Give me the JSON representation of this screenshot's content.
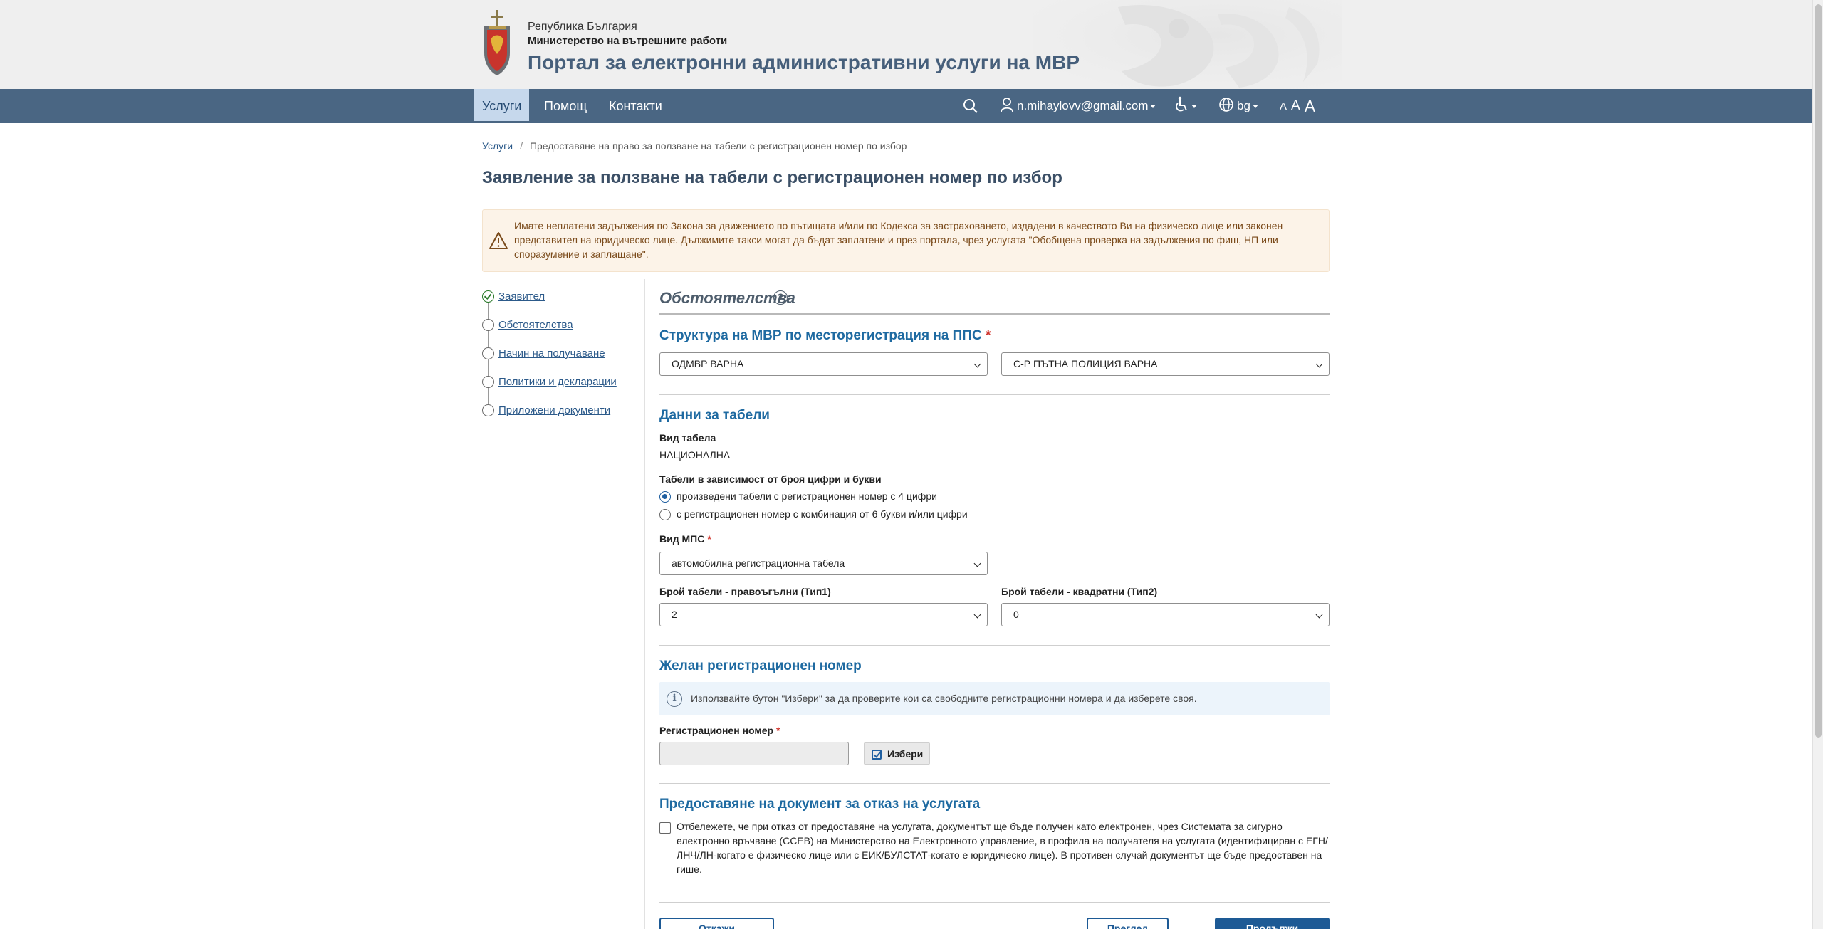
{
  "header": {
    "line1": "Република България",
    "line2": "Министерство на вътрешните работи",
    "line3": "Портал за електронни административни услуги на МВР"
  },
  "nav": {
    "items": [
      {
        "label": "Услуги",
        "active": true
      },
      {
        "label": "Помощ",
        "active": false
      },
      {
        "label": "Контакти",
        "active": false
      }
    ],
    "user_email": "n.mihaylovv@gmail.com",
    "language": "bg",
    "font_size_labels": [
      "A",
      "A",
      "A"
    ]
  },
  "breadcrumb": {
    "root": "Услуги",
    "separator": "/",
    "current": "Предоставяне на право за ползване на табели с регистрационен номер по избор"
  },
  "page_title": "Заявление за ползване на табели с регистрационен номер по избор",
  "alert": {
    "text": "Имате неплатени задължения по Закона за движението по пътищата и/или по Кодекса за застраховането, издадени в качеството Ви на физическо лице или законен представител на юридическо лице. Дължимите такси могат да бъдат заплатени и през портала, чрез услугата \"Обобщена проверка на задължения по фиш, НП или споразумение и заплащане\"."
  },
  "steps": [
    {
      "label": "Заявител",
      "done": true
    },
    {
      "label": "Обстоятелства",
      "done": false
    },
    {
      "label": "Начин на получаване",
      "done": false
    },
    {
      "label": "Политики и декларации",
      "done": false
    },
    {
      "label": "Приложени документи",
      "done": false
    }
  ],
  "form": {
    "section_title": "Обстоятелства",
    "help_symbol": "?",
    "structure": {
      "heading": "Структура на МВР по месторегистрация на ППС",
      "required_mark": "*",
      "select1": "ОДМВР ВАРНА",
      "select2": "С-Р ПЪТНА ПОЛИЦИЯ ВАРНА"
    },
    "plates": {
      "heading": "Данни за табели",
      "plate_type_label": "Вид табела",
      "plate_type_value": "НАЦИОНАЛНА",
      "digits_label": "Табели в зависимост от броя цифри и букви",
      "radio1": "произведени табели с регистрационен номер с 4 цифри",
      "radio2": "с регистрационен номер с комбинация от 6 букви и/или цифри",
      "selected_radio": 1,
      "vehicle_label": "Вид МПС",
      "vehicle_value": "автомобилна регистрационна табела",
      "rect_label": "Брой табели - правоъгълни (Тип1)",
      "rect_value": "2",
      "square_label": "Брой табели - квадратни (Тип2)",
      "square_value": "0"
    },
    "desired": {
      "heading": "Желан регистрационен номер",
      "info_symbol": "i",
      "info": "Използвайте бутон \"Избери\" за да проверите кои са свободните регистрационни номера и да изберете своя.",
      "reg_label": "Регистрационен номер",
      "reg_value": "",
      "choose_button": "Избери"
    },
    "refusal": {
      "heading": "Предоставяне на документ за отказ на услугата",
      "checked": false,
      "text": "Отбележете, че при отказ от предоставяне на услугата, документът ще бъде получен като електронен, чрез Системата за сигурно електронно връчване (ССЕВ) на Министерство на Електронното управление, в профила на получателя на услугата (идентифициран с ЕГН/ЛНЧ/ЛН-когато е физическо лице или с ЕИК/БУЛСТАТ-когато е юридическо лице). В противен случай документът ще бъде предоставен на гише."
    },
    "buttons": {
      "cancel": "Откажи",
      "preview": "Преглед",
      "continue": "Продължи"
    }
  },
  "colors": {
    "nav_bg": "#4a6683",
    "title": "#3b4f66",
    "accent": "#1e6aa1",
    "primary_button": "#1d5a95",
    "alert_bg": "#fcf3e8"
  }
}
